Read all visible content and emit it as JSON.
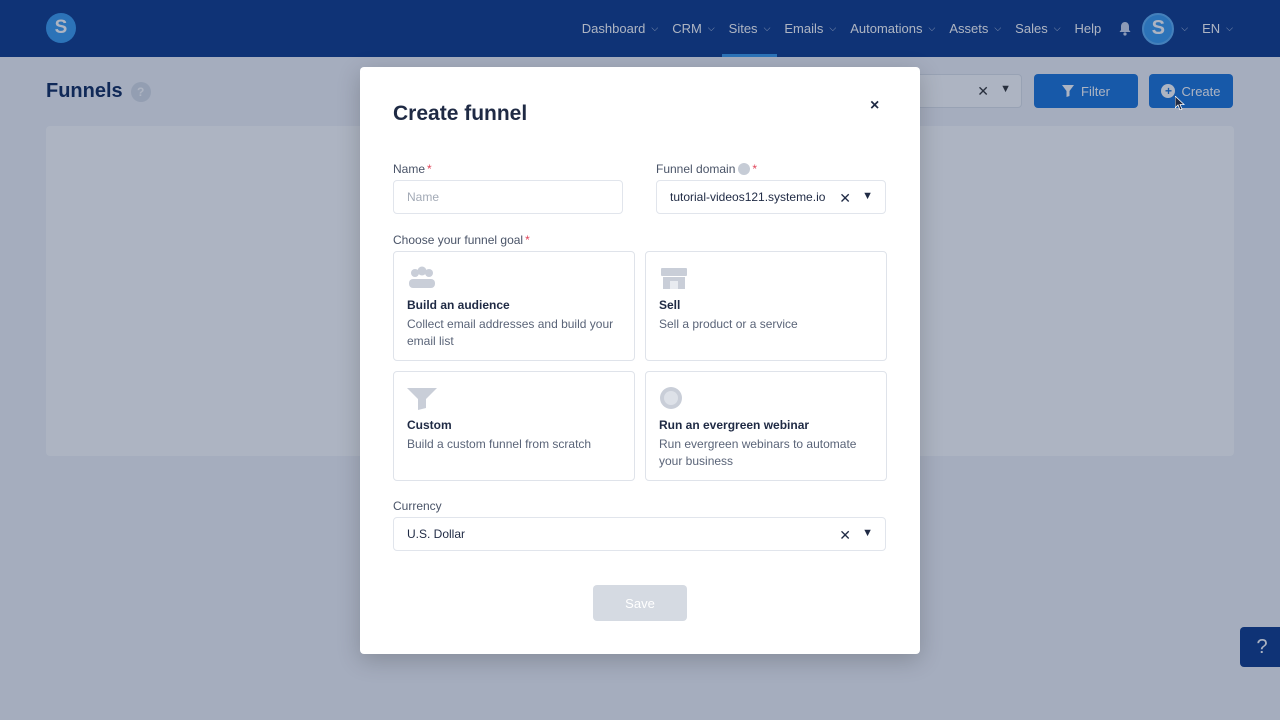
{
  "nav": {
    "logo": "S",
    "items": [
      {
        "label": "Dashboard",
        "chevron": true
      },
      {
        "label": "CRM",
        "chevron": true
      },
      {
        "label": "Sites",
        "chevron": true,
        "active": true
      },
      {
        "label": "Emails",
        "chevron": true
      },
      {
        "label": "Automations",
        "chevron": true
      },
      {
        "label": "Assets",
        "chevron": true
      },
      {
        "label": "Sales",
        "chevron": true
      },
      {
        "label": "Help",
        "chevron": false
      }
    ],
    "avatar": "S",
    "language": "EN"
  },
  "page": {
    "title": "Funnels",
    "help": "?",
    "filter_label": "Filter",
    "create_label": "Create",
    "support": "?"
  },
  "modal": {
    "title": "Create funnel",
    "close": "×",
    "name_label": "Name",
    "name_placeholder": "Name",
    "domain_label": "Funnel domain",
    "domain_value": "tutorial-videos121.systeme.io",
    "goal_label": "Choose your funnel goal",
    "goals": [
      {
        "icon": "people-icon",
        "title": "Build an audience",
        "desc": "Collect email addresses and build your email list"
      },
      {
        "icon": "store-icon",
        "title": "Sell",
        "desc": "Sell a product or a service"
      },
      {
        "icon": "funnel-icon",
        "title": "Custom",
        "desc": "Build a custom funnel from scratch"
      },
      {
        "icon": "webinar-icon",
        "title": "Run an evergreen webinar",
        "desc": "Run evergreen webinars to automate your business"
      }
    ],
    "currency_label": "Currency",
    "currency_value": "U.S. Dollar",
    "save_label": "Save",
    "required_mark": "*"
  },
  "colors": {
    "nav_bg": "#0d3a8a",
    "primary": "#1a73d9",
    "accent": "#3a9bf0",
    "required": "#e0455a"
  }
}
